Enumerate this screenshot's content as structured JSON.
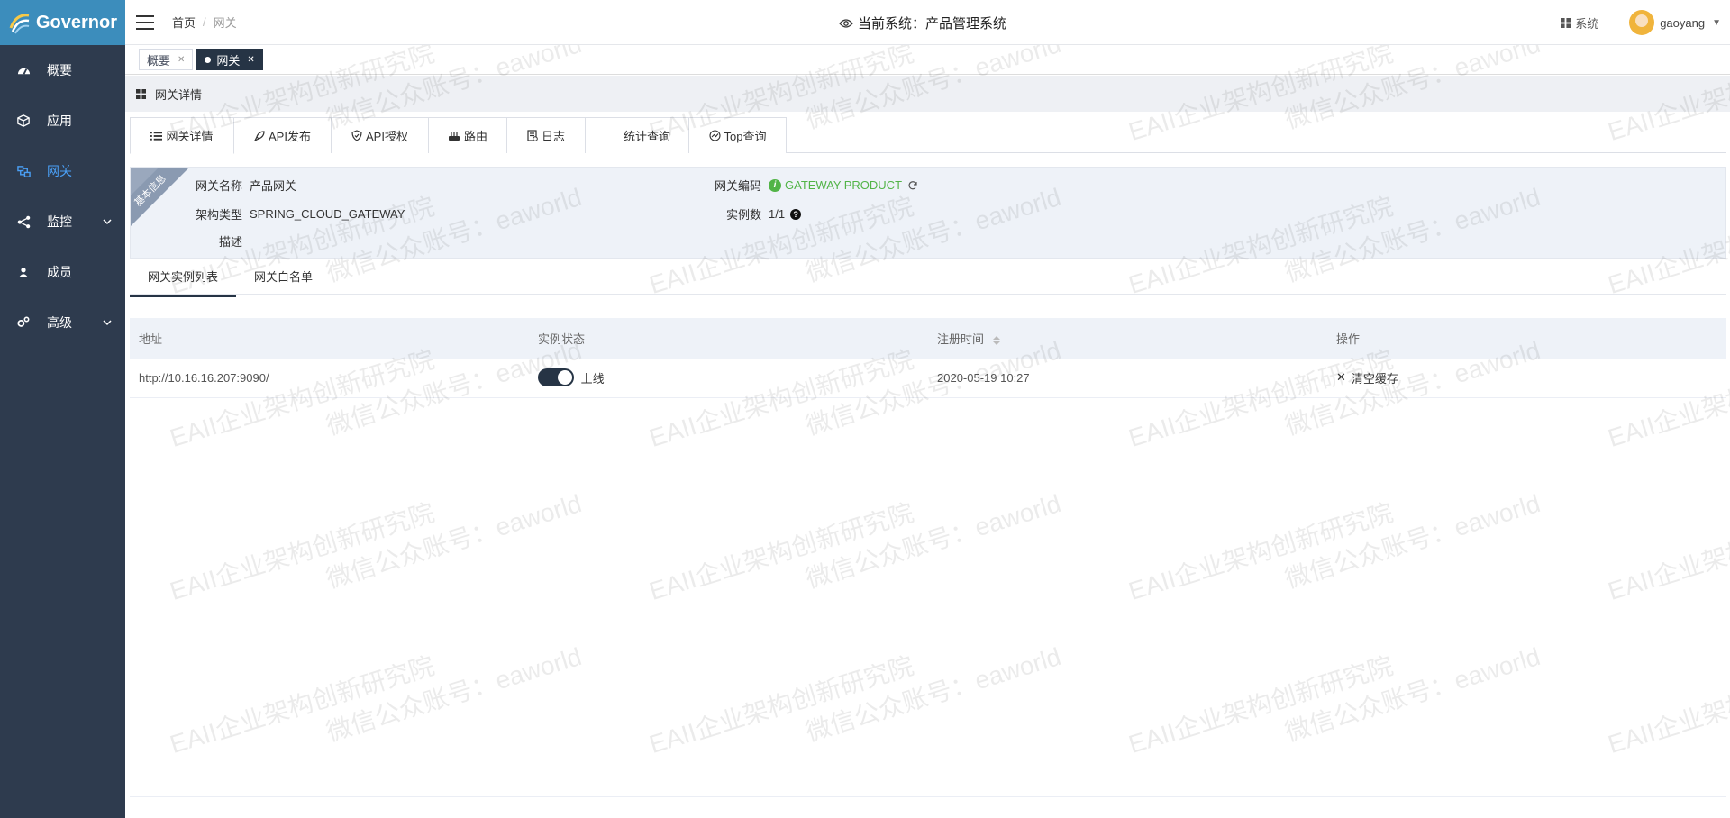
{
  "app": {
    "name": "Governor"
  },
  "sidebar": {
    "items": [
      {
        "label": "概要",
        "icon": "dashboard-icon"
      },
      {
        "label": "应用",
        "icon": "cube-icon"
      },
      {
        "label": "网关",
        "icon": "gateway-icon",
        "active": true
      },
      {
        "label": "监控",
        "icon": "share-icon",
        "expandable": true
      },
      {
        "label": "成员",
        "icon": "user-icon"
      },
      {
        "label": "高级",
        "icon": "gears-icon",
        "expandable": true
      }
    ]
  },
  "header": {
    "breadcrumb": [
      "首页",
      "网关"
    ],
    "breadcrumb_sep": "/",
    "current_system": "当前系统：产品管理系统",
    "system_label": "系统",
    "username": "gaoyang"
  },
  "tags": [
    {
      "label": "概要",
      "active": false
    },
    {
      "label": "网关",
      "active": true
    }
  ],
  "page_bar": {
    "title": "网关详情"
  },
  "detail_tabs": [
    {
      "label": "网关详情",
      "icon": "list-icon",
      "active": true
    },
    {
      "label": "API发布",
      "icon": "rocket-icon"
    },
    {
      "label": "API授权",
      "icon": "shield-icon"
    },
    {
      "label": "路由",
      "icon": "router-icon"
    },
    {
      "label": "日志",
      "icon": "log-icon"
    },
    {
      "label": "统计查询",
      "icon": ""
    },
    {
      "label": "Top查询",
      "icon": "chart-icon"
    }
  ],
  "info": {
    "ribbon": "基本信息",
    "gateway_name_label": "网关名称",
    "gateway_name": "产品网关",
    "arch_type_label": "架构类型",
    "arch_type": "SPRING_CLOUD_GATEWAY",
    "desc_label": "描述",
    "desc": "",
    "gateway_code_label": "网关编码",
    "gateway_code": "GATEWAY-PRODUCT",
    "instance_count_label": "实例数",
    "instance_count": "1/1"
  },
  "sub_tabs": [
    {
      "label": "网关实例列表",
      "active": true
    },
    {
      "label": "网关白名单",
      "active": false
    }
  ],
  "table": {
    "columns": [
      "地址",
      "实例状态",
      "注册时间",
      "操作"
    ],
    "rows": [
      {
        "address": "http://10.16.16.207:9090/",
        "status": "上线",
        "status_on": true,
        "registered": "2020-05-19 10:27",
        "action": "清空缓存"
      }
    ]
  },
  "watermark": {
    "line1": "EAII企业架构创新研究院",
    "line2": "微信公众账号：eaworld"
  },
  "colors": {
    "sidebar_bg": "#2e3b4e",
    "logo_bg": "#3c8dbc",
    "accent": "#263445",
    "active_nav": "#4a9ff5",
    "success": "#52b447"
  }
}
